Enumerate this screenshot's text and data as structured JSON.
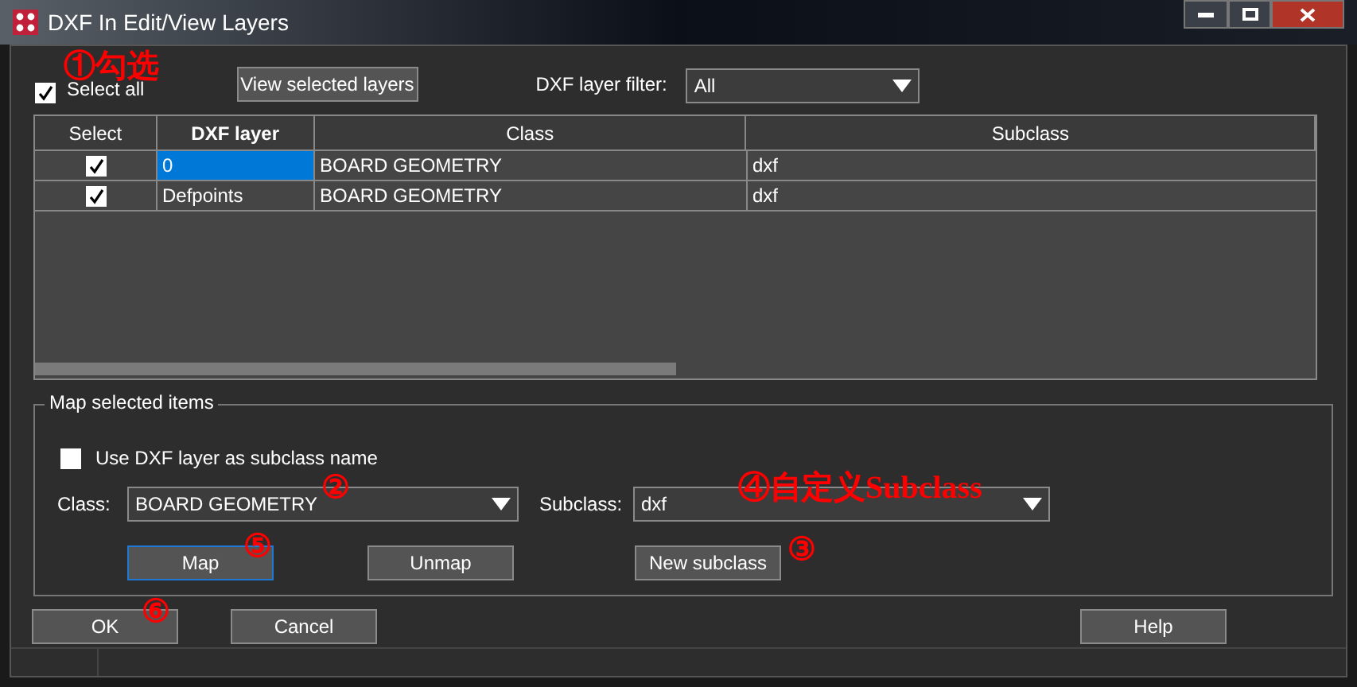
{
  "window": {
    "title": "DXF In Edit/View Layers"
  },
  "select_all": {
    "label": "Select all",
    "checked": true
  },
  "view_button": "View selected layers",
  "filter": {
    "label": "DXF layer filter:",
    "value": "All"
  },
  "table": {
    "columns": [
      "Select",
      "DXF layer",
      "Class",
      "Subclass"
    ],
    "rows": [
      {
        "checked": true,
        "layer": "0",
        "class": "BOARD GEOMETRY",
        "subclass": "dxf",
        "selected": true
      },
      {
        "checked": true,
        "layer": "Defpoints",
        "class": "BOARD GEOMETRY",
        "subclass": "dxf",
        "selected": false
      }
    ]
  },
  "map_group": {
    "title": "Map selected items",
    "use_layer": {
      "label": "Use DXF layer as subclass name",
      "checked": false
    },
    "class_label": "Class:",
    "class_value": "BOARD GEOMETRY",
    "subclass_label": "Subclass:",
    "subclass_value": "dxf",
    "buttons": [
      {
        "label": "Map",
        "focused": true
      },
      {
        "label": "Unmap",
        "focused": false
      },
      {
        "label": "New subclass",
        "focused": false
      }
    ]
  },
  "footer_buttons": [
    "OK",
    "Cancel",
    "Help"
  ],
  "annotations": [
    {
      "text": "①勾选"
    },
    {
      "text": "②"
    },
    {
      "text": "④自定义Subclass"
    },
    {
      "text": "③"
    },
    {
      "text": "⑤"
    },
    {
      "text": "⑥"
    }
  ]
}
